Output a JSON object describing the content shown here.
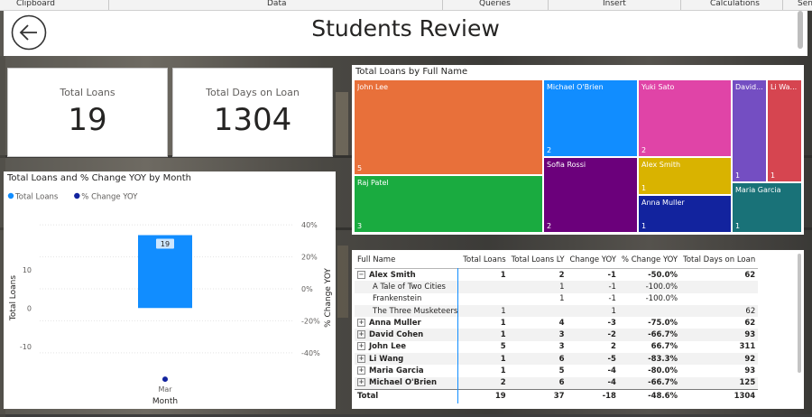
{
  "ribbon": {
    "groups": [
      "Clipboard",
      "Data",
      "Queries",
      "Insert",
      "Calculations",
      "Sen"
    ]
  },
  "header": {
    "title": "Students Review",
    "back_icon": "back-arrow-icon"
  },
  "cards": [
    {
      "label": "Total Loans",
      "value": "19"
    },
    {
      "label": "Total Days on Loan",
      "value": "1304"
    }
  ],
  "treemap": {
    "title": "Total Loans by Full Name",
    "items": [
      {
        "name": "John Lee",
        "value": 5,
        "color": "#e8703a"
      },
      {
        "name": "Raj Patel",
        "value": 3,
        "color": "#1aab40"
      },
      {
        "name": "Michael O'Brien",
        "value": 2,
        "color": "#118dff"
      },
      {
        "name": "Sofia Rossi",
        "value": 2,
        "color": "#6b007b"
      },
      {
        "name": "Yuki Sato",
        "value": 2,
        "color": "#e044a7"
      },
      {
        "name": "Alex Smith",
        "value": 1,
        "color": "#d9b300"
      },
      {
        "name": "Anna Muller",
        "value": 1,
        "color": "#12239e"
      },
      {
        "name": "David...",
        "value": 1,
        "color": "#744ec2"
      },
      {
        "name": "Li Wa...",
        "value": 1,
        "color": "#d64550"
      },
      {
        "name": "Maria Garcia",
        "value": 1,
        "color": "#197278"
      }
    ]
  },
  "chart_data": {
    "type": "bar",
    "title": "Total Loans and % Change YOY by Month",
    "legend": [
      {
        "label": "Total Loans",
        "color": "#118dff"
      },
      {
        "label": "% Change YOY",
        "color": "#12239e"
      }
    ],
    "legend_position": "top-left",
    "categories": [
      "Mar"
    ],
    "series": [
      {
        "name": "Total Loans",
        "values": [
          19
        ],
        "axis": "left"
      },
      {
        "name": "% Change YOY",
        "values": [
          -48.6
        ],
        "axis": "right"
      }
    ],
    "data_labels": [
      "19"
    ],
    "xlabel": "Month",
    "ylabel": "Total Loans",
    "y2label": "% Change YOY",
    "ylim": [
      -15,
      25
    ],
    "y2lim": [
      -48,
      48
    ],
    "yticks": [
      "10",
      "0",
      "-10"
    ],
    "y2ticks": [
      "40%",
      "20%",
      "0%",
      "-20%",
      "-40%"
    ],
    "grid": true
  },
  "table": {
    "columns": [
      "Full Name",
      "Total Loans",
      "Total Loans LY",
      "Change YOY",
      "% Change YOY",
      "Total Days on Loan"
    ],
    "rows": [
      {
        "name": "Alex Smith",
        "level": 0,
        "expand": "−",
        "cells": [
          "1",
          "2",
          "-1",
          "-50.0%",
          "62"
        ]
      },
      {
        "name": "A Tale of Two Cities",
        "level": 1,
        "cells": [
          "",
          "1",
          "-1",
          "-100.0%",
          ""
        ]
      },
      {
        "name": "Frankenstein",
        "level": 1,
        "cells": [
          "",
          "1",
          "-1",
          "-100.0%",
          ""
        ]
      },
      {
        "name": "The Three Musketeers",
        "level": 1,
        "cells": [
          "1",
          "",
          "1",
          "",
          "62"
        ]
      },
      {
        "name": "Anna Muller",
        "level": 0,
        "expand": "+",
        "cells": [
          "1",
          "4",
          "-3",
          "-75.0%",
          "62"
        ]
      },
      {
        "name": "David Cohen",
        "level": 0,
        "expand": "+",
        "cells": [
          "1",
          "3",
          "-2",
          "-66.7%",
          "93"
        ]
      },
      {
        "name": "John Lee",
        "level": 0,
        "expand": "+",
        "cells": [
          "5",
          "3",
          "2",
          "66.7%",
          "311"
        ]
      },
      {
        "name": "Li Wang",
        "level": 0,
        "expand": "+",
        "cells": [
          "1",
          "6",
          "-5",
          "-83.3%",
          "92"
        ]
      },
      {
        "name": "Maria Garcia",
        "level": 0,
        "expand": "+",
        "cells": [
          "1",
          "5",
          "-4",
          "-80.0%",
          "93"
        ]
      },
      {
        "name": "Michael O'Brien",
        "level": 0,
        "expand": "+",
        "cells": [
          "2",
          "6",
          "-4",
          "-66.7%",
          "125"
        ]
      }
    ],
    "total": {
      "name": "Total",
      "cells": [
        "19",
        "37",
        "-18",
        "-48.6%",
        "1304"
      ]
    }
  }
}
